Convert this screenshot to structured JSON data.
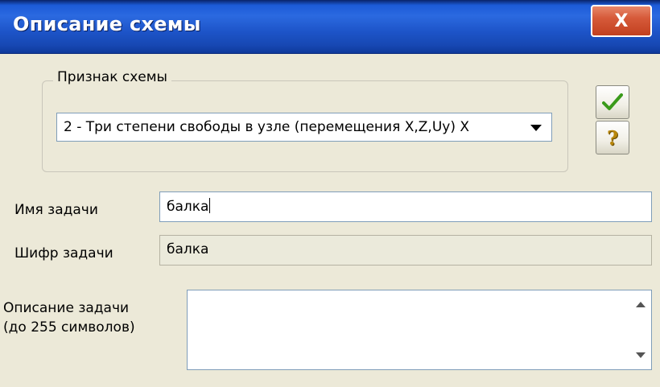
{
  "window": {
    "title": "Описание схемы",
    "close_label": "X"
  },
  "scheme_group": {
    "legend": "Признак схемы",
    "selected_option": "2 - Три степени свободы в узле (перемещения X,Z,Uy) X"
  },
  "buttons": {
    "ok_icon": "checkmark-icon",
    "help_icon": "question-icon",
    "help_glyph": "?"
  },
  "fields": {
    "task_name_label": "Имя задачи",
    "task_name_value": "балка",
    "task_code_label": "Шифр задачи",
    "task_code_value": "балка",
    "description_label_line1": "Описание задачи",
    "description_label_line2": "(до 255 символов)",
    "description_value": ""
  },
  "colors": {
    "titlebar": "#2b69e0",
    "close_button": "#d65a3a",
    "dialog_bg": "#ece9d8",
    "check_green": "#3a9a1a"
  }
}
